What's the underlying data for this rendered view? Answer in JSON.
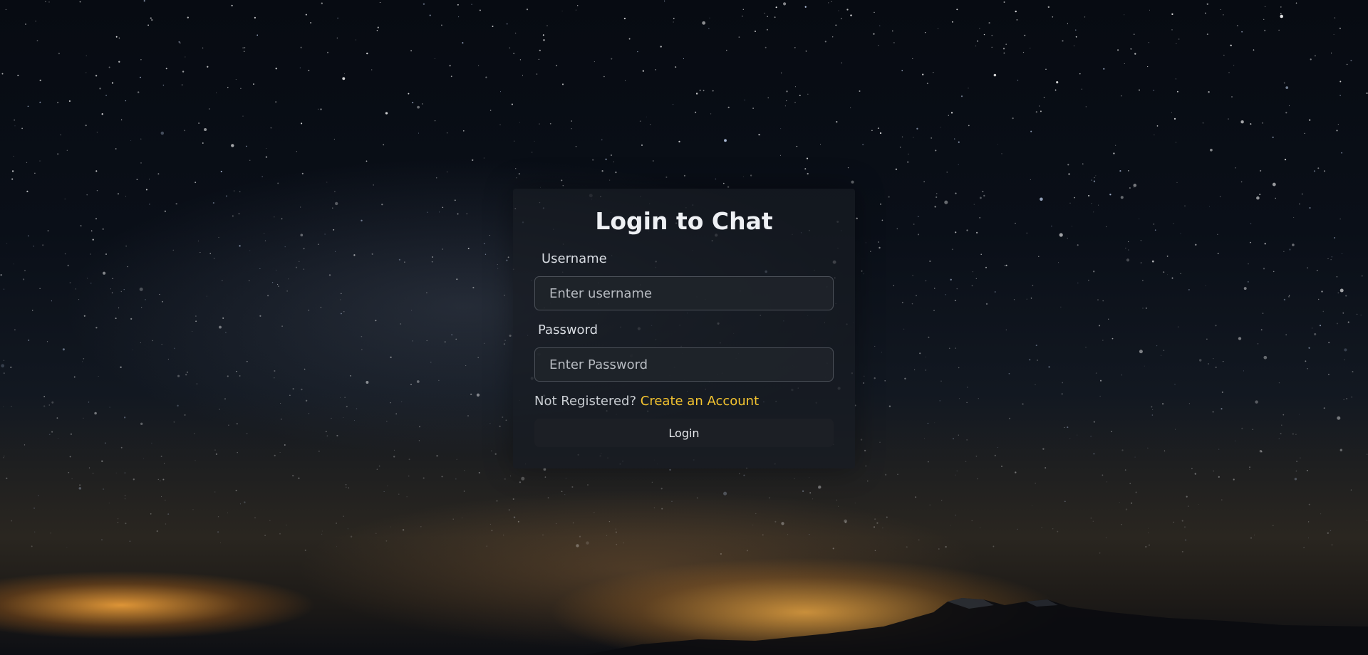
{
  "login": {
    "title": "Login to Chat",
    "username_label": "Username",
    "username_placeholder": "Enter username",
    "username_value": "",
    "password_label": "Password",
    "password_placeholder": "Enter Password",
    "password_value": "",
    "not_registered_text": "Not Registered?",
    "create_account_link": "Create an Account",
    "login_button": "Login"
  },
  "theme": {
    "link_color": "#f4c430",
    "card_color": "#181c22",
    "button_color": "#1c1f25"
  }
}
